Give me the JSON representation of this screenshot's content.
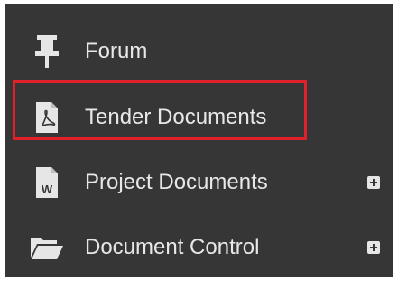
{
  "menu": {
    "items": [
      {
        "label": "Forum",
        "icon": "pin-icon",
        "expandable": false
      },
      {
        "label": "Tender Documents",
        "icon": "pdf-file-icon",
        "expandable": false,
        "highlighted": true
      },
      {
        "label": "Project Documents",
        "icon": "word-file-icon",
        "expandable": true
      },
      {
        "label": "Document Control",
        "icon": "folder-open-icon",
        "expandable": true
      }
    ]
  },
  "colors": {
    "panel_background": "#363636",
    "text": "#e8e8e8",
    "highlight": "#e0202a"
  },
  "icons": {
    "word_letter": "W"
  }
}
